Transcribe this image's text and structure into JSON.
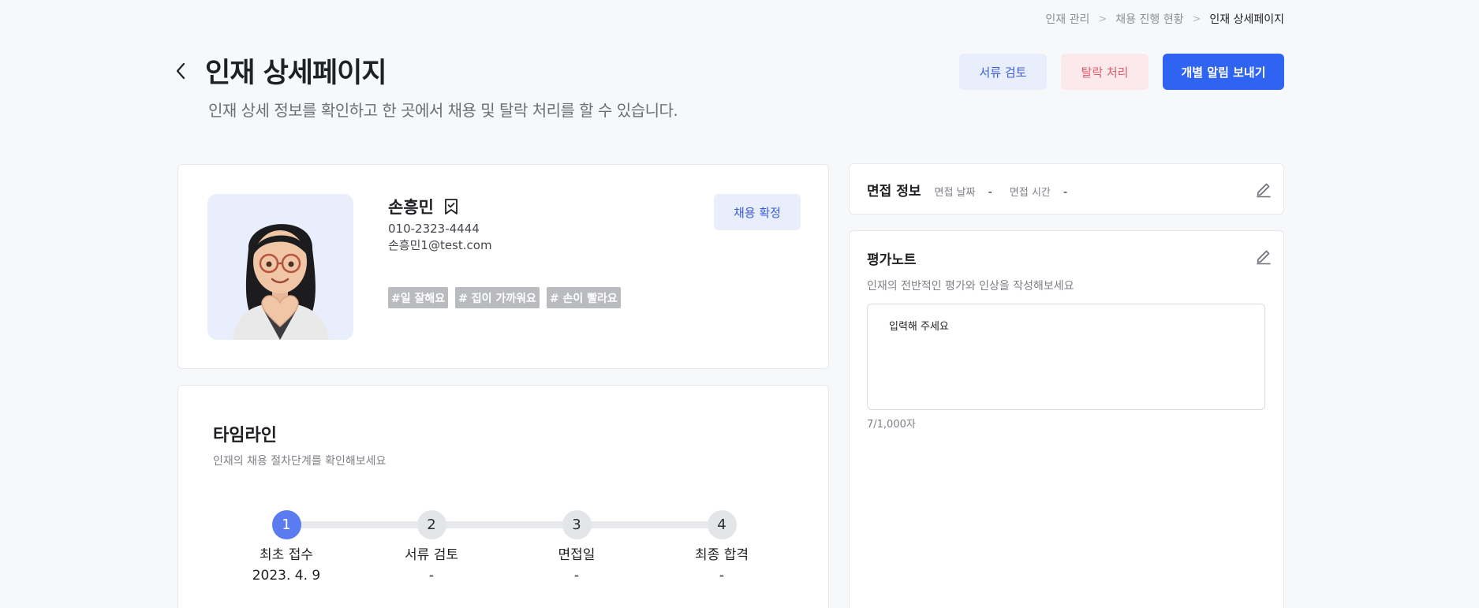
{
  "breadcrumb": {
    "items": [
      "인재 관리",
      "채용 진행 현황",
      "인재 상세페이지"
    ],
    "separator": ">"
  },
  "header": {
    "title": "인재 상세페이지",
    "subtitle": "인재 상세 정보를 확인하고 한 곳에서 채용 및 탈락 처리를 할 수 있습니다.",
    "back_icon": "chevron-left-icon"
  },
  "actions": {
    "review_label": "서류 검토",
    "drop_label": "탈락 처리",
    "notify_label": "개별 알림 보내기"
  },
  "profile": {
    "name": "손흥민",
    "bookmark_icon": "bookmark-check-icon",
    "phone": "010-2323-4444",
    "email": "손흥민1@test.com",
    "tags": [
      "#일 잘해요",
      "# 집이 가까워요",
      "# 손이 빨라요"
    ],
    "confirm_label": "채용 확정"
  },
  "timeline": {
    "title": "타임라인",
    "subtitle": "인재의 채용 절차단계를 확인해보세요",
    "steps": [
      {
        "number": "1",
        "label": "최초 접수",
        "date": "2023. 4. 9",
        "active": true
      },
      {
        "number": "2",
        "label": "서류 검토",
        "date": "-",
        "active": false
      },
      {
        "number": "3",
        "label": "면접일",
        "date": "-",
        "active": false
      },
      {
        "number": "4",
        "label": "최종 합격",
        "date": "-",
        "active": false
      }
    ]
  },
  "interview": {
    "title": "면접 정보",
    "date_label": "면접 날짜",
    "date_value": "-",
    "time_label": "면접 시간",
    "time_value": "-",
    "edit_icon": "pencil-icon"
  },
  "note": {
    "title": "평가노트",
    "subtitle": "인재의 전반적인 평가와 인상을 작성해보세요",
    "placeholder": "입력해 주세요",
    "count": "7/1,000자",
    "edit_icon": "pencil-icon"
  },
  "colors": {
    "primary": "#2f63f2",
    "primary_light": "#e8eefc",
    "danger": "#e25a66",
    "danger_light": "#fce9ec",
    "step_active": "#5b7bf0",
    "tag_bg": "#b9bbbf",
    "page_bg": "#f7f8fa"
  }
}
